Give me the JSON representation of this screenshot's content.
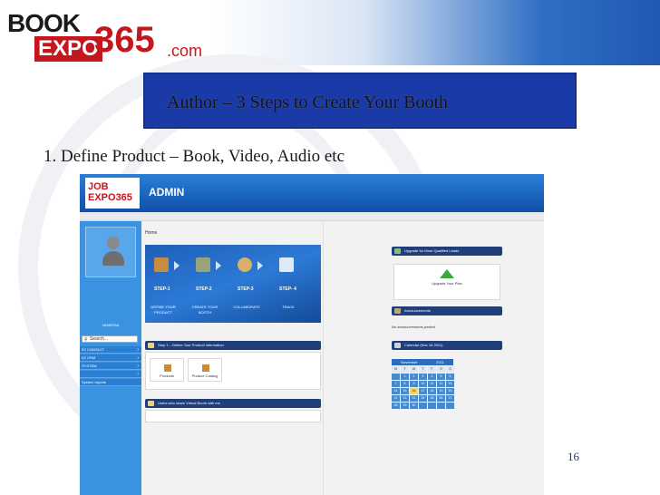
{
  "slide": {
    "logo": {
      "word1": "BOOK",
      "word2": "EXPO",
      "number": "365",
      "suffix": ".com"
    },
    "title": "Author – 3 Steps to Create Your Booth",
    "bullet": "1.  Define Product – Book, Video, Audio etc",
    "page_number": "16"
  },
  "colors": {
    "accent": "#1a3aa8",
    "admin_blue": "#2a7fd2",
    "panel_head": "#1f3e7a",
    "logo_red": "#c4161c"
  },
  "admin": {
    "logo_text": "JOB EXPO365",
    "title": "ADMIN",
    "breadcrumb": "Home",
    "user_name": "VANESSA",
    "search_placeholder": "Search...",
    "sidebar": [
      {
        "label": "E2 CONTACT",
        "icon": "chevron-right-icon"
      },
      {
        "label": "E2 CRM",
        "icon": "chevron-right-icon"
      },
      {
        "label": "SYSTEM",
        "icon": "chevron-right-icon"
      },
      {
        "label": "",
        "icon": "chevron-right-icon"
      },
      {
        "label": "System reports",
        "icon": "report-icon"
      }
    ],
    "steps": [
      {
        "label": "STEP-1",
        "desc": "DEFINE YOUR PRODUCT",
        "icon": "box-icon"
      },
      {
        "label": "STEP-2",
        "desc": "CREATE YOUR BOOTH",
        "icon": "booth-icon"
      },
      {
        "label": "STEP-3",
        "desc": "COLLABORATE",
        "icon": "handshake-icon"
      },
      {
        "label": "STEP- 4",
        "desc": "TRACK",
        "icon": "chart-icon"
      }
    ],
    "step1_panel": {
      "title": "Step 1 – Define Your Product Information",
      "tiles": [
        {
          "label": "Products"
        },
        {
          "label": "Product Catalog"
        }
      ]
    },
    "virtual_panel": {
      "title": "Users who share Virtual Booth with me"
    },
    "upgrade_panel": {
      "title": "Upgrade for More Qualified Leads",
      "button": "Upgrade Your Plan"
    },
    "announcements_panel": {
      "title": "Announcements",
      "text": "No announcements posted"
    },
    "calendar_panel": {
      "title": "Calendar (Nov 16 2011)",
      "month": "November",
      "year": "2011",
      "days_of_week": [
        "M",
        "T",
        "W",
        "T",
        "F",
        "S",
        "S"
      ],
      "rows": [
        [
          "",
          "1",
          "2",
          "3",
          "4",
          "5",
          "6"
        ],
        [
          "7",
          "8",
          "9",
          "10",
          "11",
          "12",
          "13"
        ],
        [
          "14",
          "15",
          "16",
          "17",
          "18",
          "19",
          "20"
        ],
        [
          "21",
          "22",
          "23",
          "24",
          "25",
          "26",
          "27"
        ],
        [
          "28",
          "29",
          "30",
          "",
          "",
          "",
          ""
        ]
      ],
      "today": "16"
    }
  }
}
